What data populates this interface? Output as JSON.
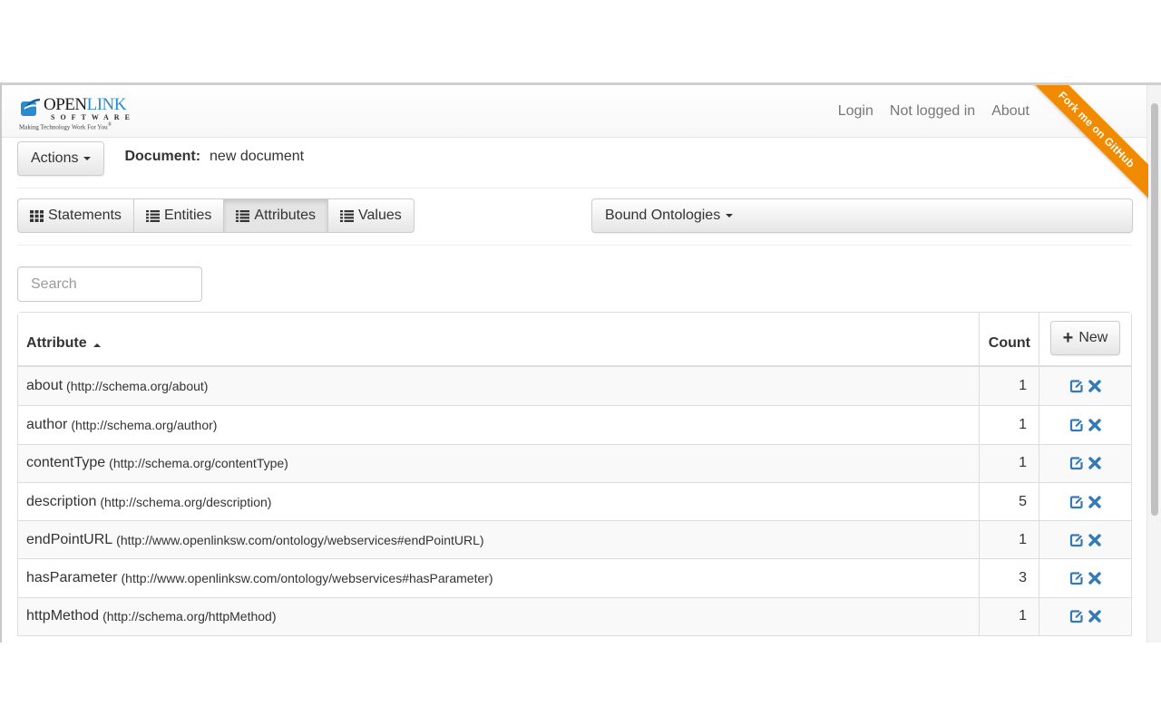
{
  "navbar": {
    "logo": {
      "brand_open": "OPEN",
      "brand_link": "LINK",
      "subtitle": "SOFTWARE",
      "tagline": "Making Technology Work For You",
      "registered": "®"
    },
    "links": [
      {
        "label": "Login"
      },
      {
        "label": "Not logged in"
      },
      {
        "label": "About"
      }
    ],
    "ribbon": "Fork me on GitHub"
  },
  "toolbar": {
    "actions_label": "Actions",
    "document_label": "Document:",
    "document_name": "new document"
  },
  "tabs": [
    {
      "label": "Statements",
      "icon": "grid-icon",
      "active": false
    },
    {
      "label": "Entities",
      "icon": "list-icon",
      "active": false
    },
    {
      "label": "Attributes",
      "icon": "list-icon",
      "active": true
    },
    {
      "label": "Values",
      "icon": "list-icon",
      "active": false
    }
  ],
  "bound_ontologies_label": "Bound Ontologies",
  "search": {
    "placeholder": "Search",
    "value": ""
  },
  "table": {
    "headers": {
      "attribute": "Attribute",
      "count": "Count",
      "new_button": "New"
    },
    "sort": {
      "column": "attribute",
      "direction": "ascending"
    },
    "rows": [
      {
        "name": "about",
        "uri": "(http://schema.org/about)",
        "count": "1"
      },
      {
        "name": "author",
        "uri": "(http://schema.org/author)",
        "count": "1"
      },
      {
        "name": "contentType",
        "uri": "(http://schema.org/contentType)",
        "count": "1"
      },
      {
        "name": "description",
        "uri": "(http://schema.org/description)",
        "count": "5"
      },
      {
        "name": "endPointURL",
        "uri": "(http://www.openlinksw.com/ontology/webservices#endPointURL)",
        "count": "1"
      },
      {
        "name": "hasParameter",
        "uri": "(http://www.openlinksw.com/ontology/webservices#hasParameter)",
        "count": "3"
      },
      {
        "name": "httpMethod",
        "uri": "(http://schema.org/httpMethod)",
        "count": "1"
      }
    ]
  },
  "colors": {
    "ribbon": "#f28a00",
    "action_icon": "#337ab7",
    "logo_link": "#2a8ccf"
  }
}
